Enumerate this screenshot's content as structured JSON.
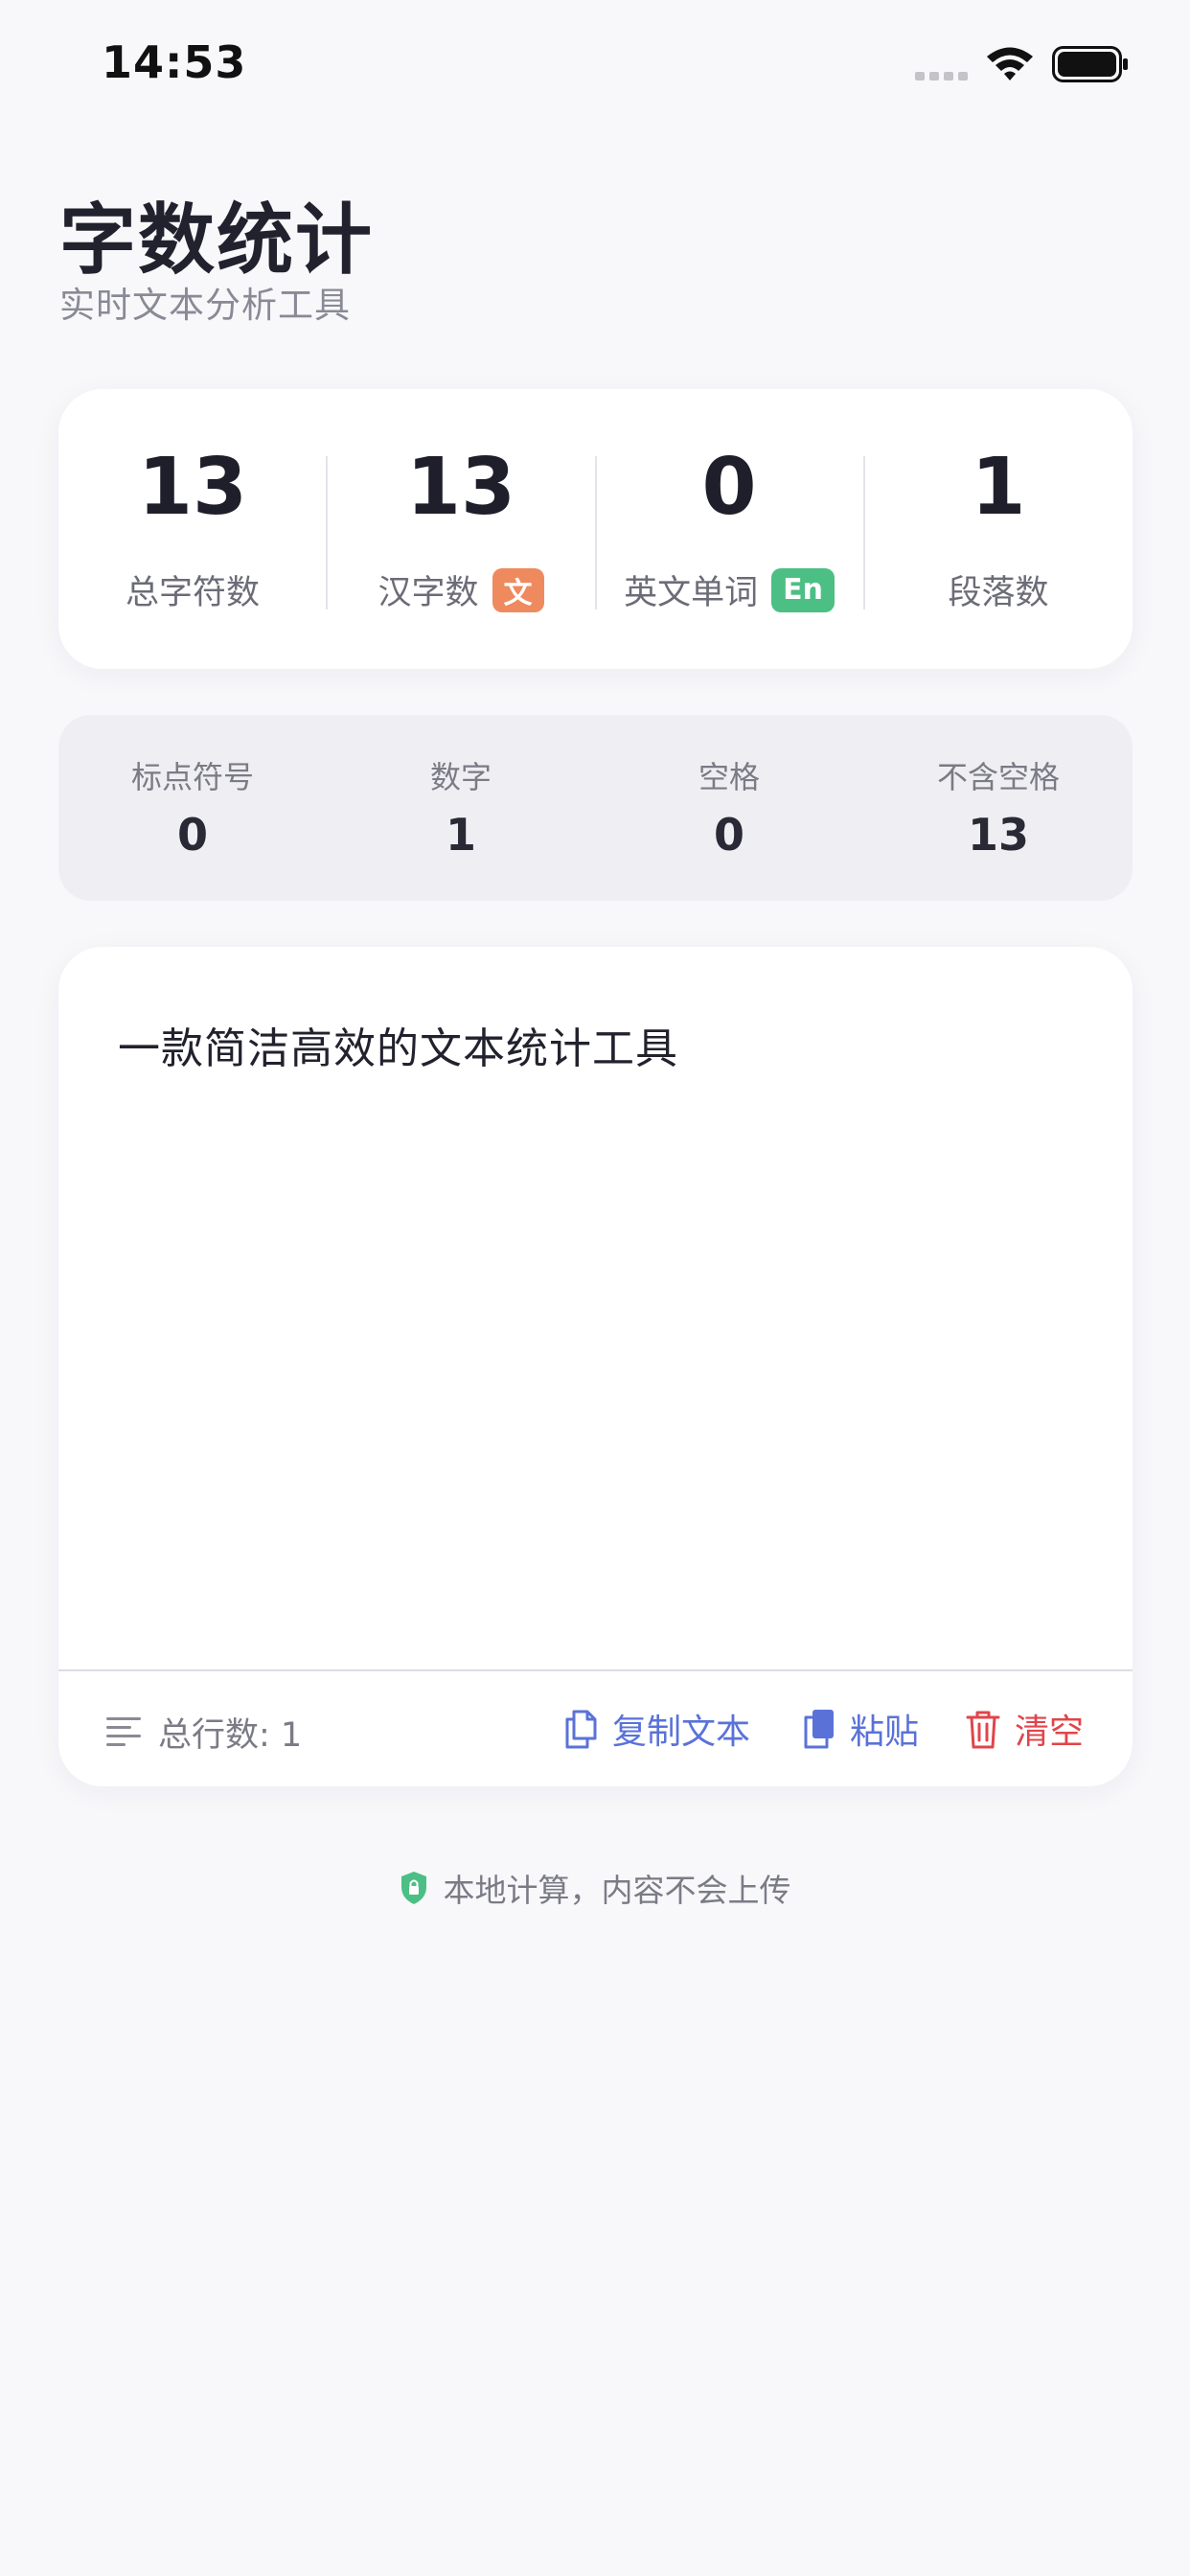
{
  "status_bar": {
    "time": "14:53"
  },
  "header": {
    "title": "字数统计",
    "subtitle": "实时文本分析工具"
  },
  "main_stats": [
    {
      "value": "13",
      "label": "总字符数",
      "badge": null
    },
    {
      "value": "13",
      "label": "汉字数",
      "badge": "文",
      "badge_color": "#ee8a5e"
    },
    {
      "value": "0",
      "label": "英文单词",
      "badge": "En",
      "badge_color": "#4cbf84"
    },
    {
      "value": "1",
      "label": "段落数",
      "badge": null
    }
  ],
  "sub_stats": [
    {
      "label": "标点符号",
      "value": "0"
    },
    {
      "label": "数字",
      "value": "1"
    },
    {
      "label": "空格",
      "value": "0"
    },
    {
      "label": "不含空格",
      "value": "13"
    }
  ],
  "editor": {
    "text": "一款简洁高效的文本统计工具",
    "line_count": "总行数: 1",
    "copy_label": "复制文本",
    "paste_label": "粘贴",
    "clear_label": "清空"
  },
  "footer": {
    "privacy_note": "本地计算，内容不会上传"
  },
  "colors": {
    "accent_blue": "#5a72d8",
    "danger_red": "#e0454a",
    "shield_green": "#4cbf84"
  }
}
